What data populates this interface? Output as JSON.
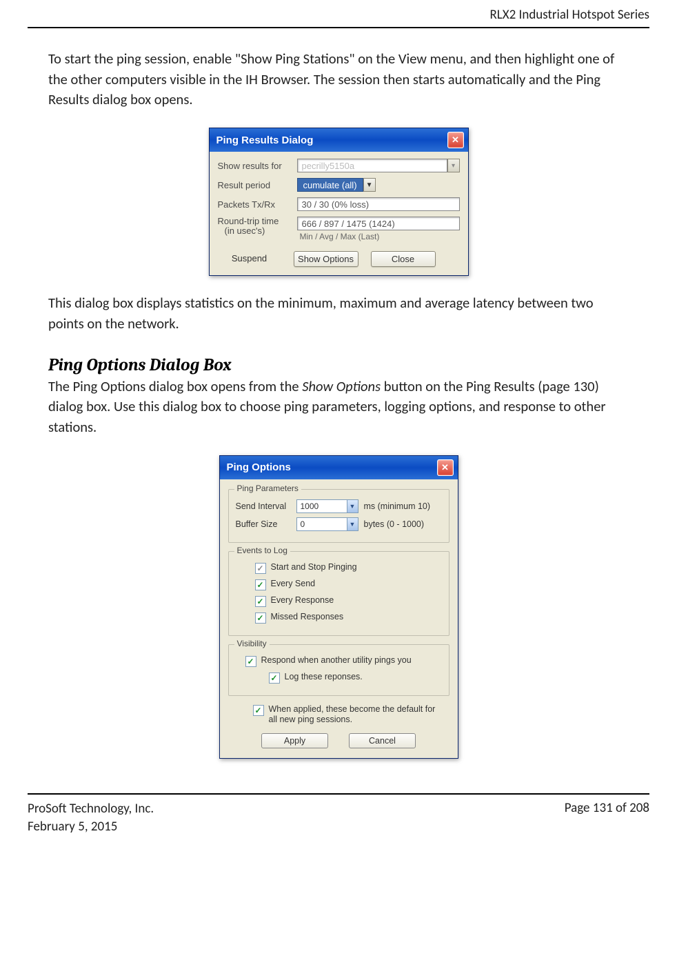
{
  "header": {
    "title": "RLX2 Industrial Hotspot Series"
  },
  "intro_para": "To start the ping session, enable \"Show Ping Stations\" on the View menu, and then highlight one of the other computers visible in the IH Browser. The session then starts automatically and the Ping Results dialog box opens.",
  "ping_results_dialog": {
    "title": "Ping Results Dialog",
    "labels": {
      "show_results_for": "Show results for",
      "result_period": "Result period",
      "packets": "Packets Tx/Rx",
      "rtt": "Round-trip time",
      "rtt_sub": "(in usec's)"
    },
    "values": {
      "show_results_for": "pecrilly5150a",
      "result_period": "cumulate (all)",
      "packets": "30 / 30  (0% loss)",
      "rtt": "666 / 897 / 1475 (1424)",
      "rtt_sub": "Min  / Avg  / Max   (Last)"
    },
    "buttons": {
      "suspend": "Suspend",
      "show_options": "Show Options",
      "close": "Close"
    }
  },
  "after_para": "This dialog box displays statistics on the minimum, maximum and average latency between two points on the network.",
  "section_heading": "Ping Options Dialog Box",
  "section_para_1": "The Ping Options dialog box opens from the ",
  "section_para_em": "Show Options",
  "section_para_2": " button on the Ping Results (page 130) dialog box. Use this dialog box to choose ping parameters, logging options, and response to other stations.",
  "ping_options_dialog": {
    "title": "Ping Options",
    "groups": {
      "params": {
        "legend": "Ping Parameters",
        "send_interval_label": "Send Interval",
        "send_interval_value": "1000",
        "send_interval_suffix": "ms (minimum 10)",
        "buffer_size_label": "Buffer Size",
        "buffer_size_value": "0",
        "buffer_size_suffix": "bytes (0 - 1000)"
      },
      "events": {
        "legend": "Events to Log",
        "start_stop": "Start and Stop Pinging",
        "every_send": "Every Send",
        "every_response": "Every Response",
        "missed": "Missed Responses"
      },
      "visibility": {
        "legend": "Visibility",
        "respond": "Respond when another utility pings you",
        "log_these": "Log these reponses."
      }
    },
    "default_note": "When applied, these become the default for all new ping sessions.",
    "buttons": {
      "apply": "Apply",
      "cancel": "Cancel"
    }
  },
  "footer": {
    "company": "ProSoft Technology, Inc.",
    "date": "February 5, 2015",
    "page": "Page 131 of 208"
  }
}
